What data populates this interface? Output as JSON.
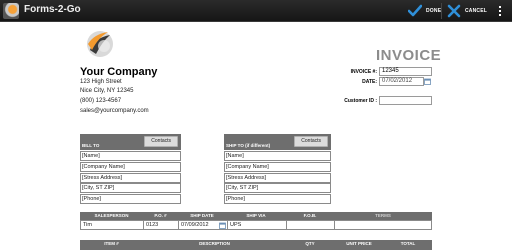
{
  "app": {
    "title": "Forms-2-Go",
    "icon": "app-logo-icon"
  },
  "actions": {
    "done_label": "DONE",
    "cancel_label": "CANCEL",
    "done_color": "#2f8fd8",
    "cancel_color": "#2f8fd8"
  },
  "company": {
    "name": "Your Company",
    "lines": [
      "123 High Street",
      "Nice City, NY 12345",
      "(800) 123-4567",
      "sales@yourcompany.com"
    ]
  },
  "invoice": {
    "title": "INVOICE",
    "number_label": "INVOICE #:",
    "number_value": "12345",
    "date_label": "DATE:",
    "date_value": "07/02/2012",
    "customer_label": "Customer ID :",
    "customer_value": ""
  },
  "bill_to": {
    "header": "BILL TO",
    "contacts_label": "Contacts",
    "fields": [
      "[Name]",
      "[Company Name]",
      "[Stress Address]",
      "[City, ST ZIP]",
      "[Phone]"
    ]
  },
  "ship_to": {
    "header": "SHIP TO (if different)",
    "contacts_label": "Contacts",
    "fields": [
      "[Name]",
      "[Company Name]",
      "[Stress Address]",
      "[City, ST ZIP]",
      "[Phone]"
    ]
  },
  "shipping_table": {
    "headers": [
      "SALESPERSON",
      "P.O. #",
      "SHIP DATE",
      "SHIP VIA",
      "F.O.B.",
      "TERMS"
    ],
    "row": [
      "Tim",
      "0123",
      "07/09/2012",
      "UPS",
      "",
      ""
    ]
  },
  "items_table": {
    "headers": [
      "ITEM #",
      "DESCRIPTION",
      "QTY",
      "UNIT PRICE",
      "TOTAL"
    ]
  },
  "colors": {
    "header_gray": "#6e6e6e",
    "invoice_title": "#8c8c8c",
    "logo_orange": "#f39a2e"
  }
}
